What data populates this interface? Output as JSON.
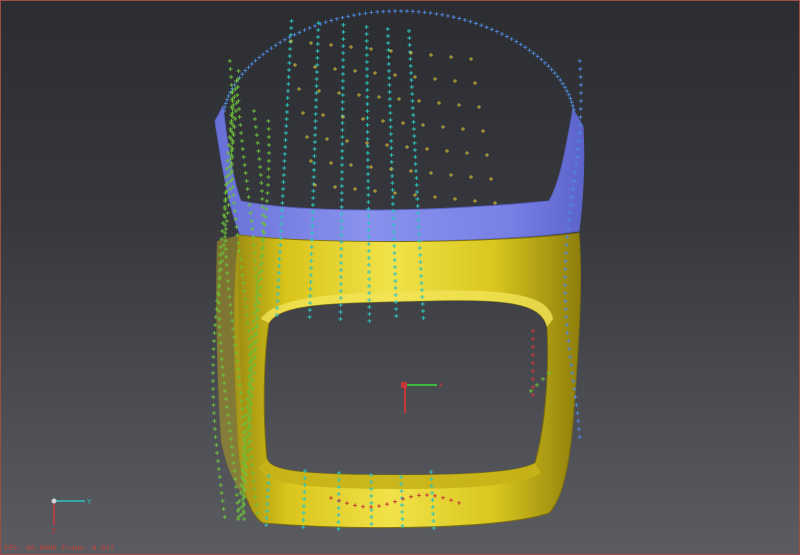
{
  "viewport": {
    "status_text": "FPS: 60.0000  Frame: 0.017",
    "border_color": "#a24a44",
    "background_top": "#2b2d31",
    "background_bottom": "#5a5c61"
  },
  "model": {
    "surface_color_main": "#e6d21c",
    "surface_color_band": "#8088e8",
    "marker_colors": [
      "#4f88d8",
      "#2ec4c0",
      "#6dbf3a",
      "#c8b23c",
      "#c8383a"
    ]
  },
  "axis_triad": {
    "y_label": "Y",
    "z_label": "Z",
    "x_label": "X"
  },
  "pivot_gizmo": {
    "x_color": "#c8383a",
    "y_color": "#3ab840",
    "z_color": "#c8383a"
  }
}
